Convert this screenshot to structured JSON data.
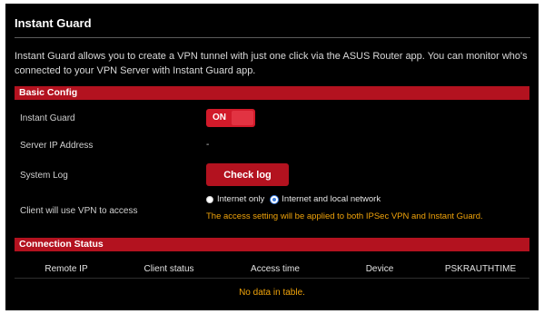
{
  "page": {
    "title": "Instant Guard",
    "description": "Instant Guard allows you to create a VPN tunnel with just one click via the ASUS Router app. You can monitor who's connected to your VPN Server with Instant Guard app."
  },
  "basic_config": {
    "header": "Basic Config",
    "instant_guard_label": "Instant Guard",
    "instant_guard_toggle": "ON",
    "server_ip_label": "Server IP Address",
    "server_ip_value": "-",
    "system_log_label": "System Log",
    "check_log_button": "Check log",
    "client_access_label": "Client will use VPN to access",
    "option_internet_only": "Internet only",
    "option_internet_local": "Internet and local network",
    "selected_option": "Internet and local network",
    "access_note": "The access setting will be applied to both IPSec VPN and Instant Guard."
  },
  "connection_status": {
    "header": "Connection Status",
    "columns": [
      "Remote IP",
      "Client status",
      "Access time",
      "Device",
      "PSKRAUTHTIME"
    ],
    "empty_message": "No data in table."
  },
  "colors": {
    "accent_red": "#b3121f",
    "background": "#000000",
    "note_orange": "#f0a30a",
    "radio_selected": "#3b7dde"
  }
}
